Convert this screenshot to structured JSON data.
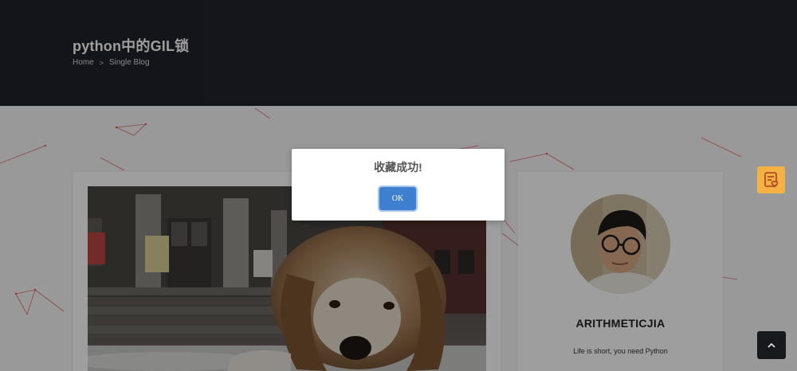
{
  "banner": {
    "title": "python中的GIL锁",
    "breadcrumb": {
      "home": "Home",
      "separator": ">",
      "current": "Single Blog"
    }
  },
  "sidebar": {
    "author_name": "ARITHMETICJIA",
    "bio": "Life is short, you need Python"
  },
  "modal": {
    "message": "收藏成功!",
    "ok_label": "OK"
  },
  "floating": {
    "favorite_icon": "favorite-list-icon",
    "back_to_top_icon": "chevron-up-icon"
  },
  "colors": {
    "banner_bg": "#21232b",
    "favorite_button": "#f4b244",
    "ok_button": "#3f7fcf"
  }
}
